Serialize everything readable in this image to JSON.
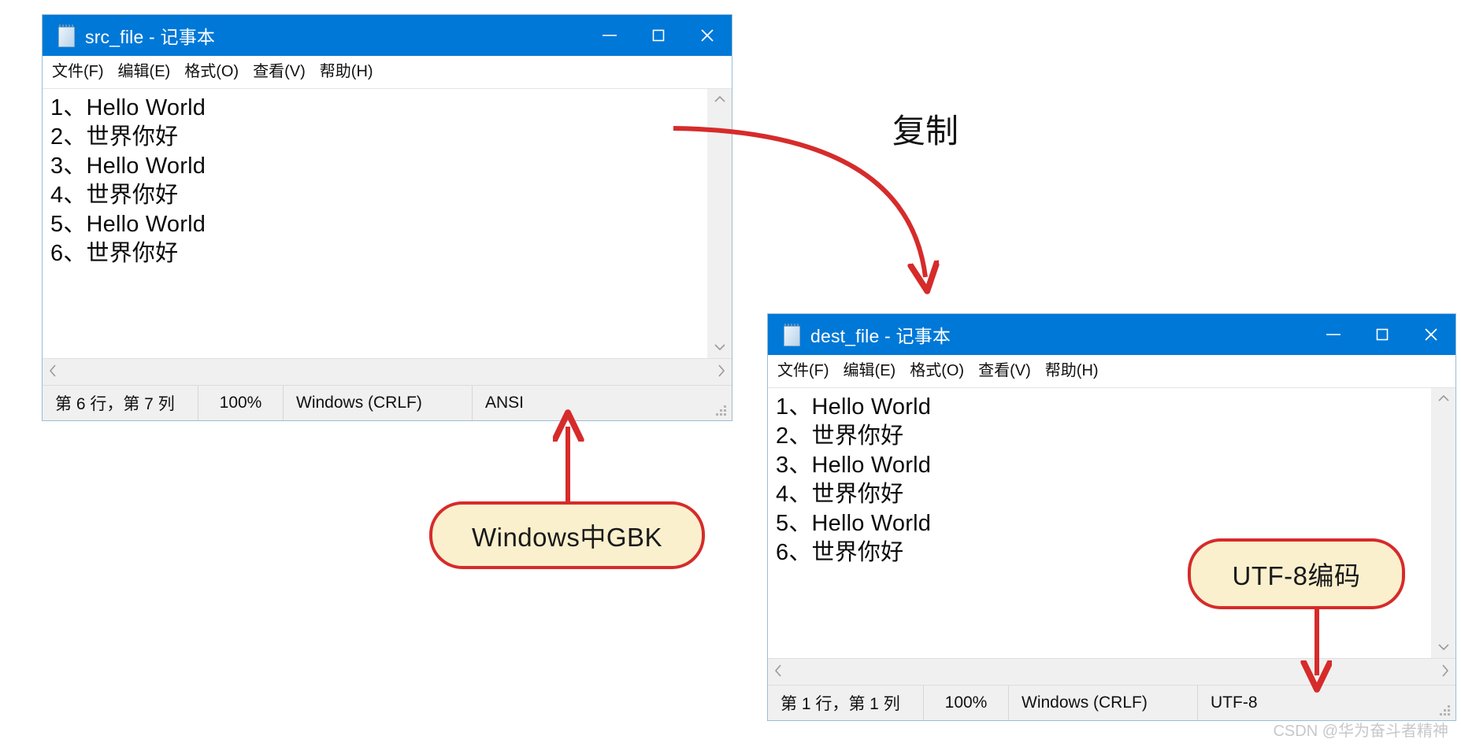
{
  "meta": {
    "watermark": "CSDN @华为奋斗者精神"
  },
  "annotations": {
    "copy_label": "复制",
    "callout_gbk": "Windows中GBK",
    "callout_utf8": "UTF-8编码",
    "accent_red": "#d62b2b",
    "callout_fill": "#faf0cd",
    "titlebar_blue": "#0078d7"
  },
  "windows": [
    {
      "id": "src",
      "title": "src_file - 记事本",
      "app_icon": "notepad-icon",
      "caption_buttons": [
        {
          "name": "minimize",
          "glyph": "—"
        },
        {
          "name": "maximize",
          "glyph": "▢"
        },
        {
          "name": "close",
          "glyph": "✕"
        }
      ],
      "menu": [
        "文件(F)",
        "编辑(E)",
        "格式(O)",
        "查看(V)",
        "帮助(H)"
      ],
      "text_lines": [
        "1、Hello World",
        "2、世界你好",
        "3、Hello World",
        "4、世界你好",
        "5、Hello World",
        "6、世界你好"
      ],
      "status": {
        "position": "第 6 行，第 7 列",
        "zoom": "100%",
        "line_ending": "Windows (CRLF)",
        "encoding": "ANSI"
      },
      "scrollbars": {
        "vertical_up": "⌃",
        "vertical_down": "⌄",
        "horizontal_left": "‹",
        "horizontal_right": "›"
      }
    },
    {
      "id": "dest",
      "title": "dest_file - 记事本",
      "app_icon": "notepad-icon",
      "caption_buttons": [
        {
          "name": "minimize",
          "glyph": "—"
        },
        {
          "name": "maximize",
          "glyph": "▢"
        },
        {
          "name": "close",
          "glyph": "✕"
        }
      ],
      "menu": [
        "文件(F)",
        "编辑(E)",
        "格式(O)",
        "查看(V)",
        "帮助(H)"
      ],
      "text_lines": [
        "1、Hello World",
        "2、世界你好",
        "3、Hello World",
        "4、世界你好",
        "5、Hello World",
        "6、世界你好"
      ],
      "status": {
        "position": "第 1 行，第 1 列",
        "zoom": "100%",
        "line_ending": "Windows (CRLF)",
        "encoding": "UTF-8"
      },
      "scrollbars": {
        "vertical_up": "⌃",
        "vertical_down": "⌄",
        "horizontal_left": "‹",
        "horizontal_right": "›"
      }
    }
  ]
}
